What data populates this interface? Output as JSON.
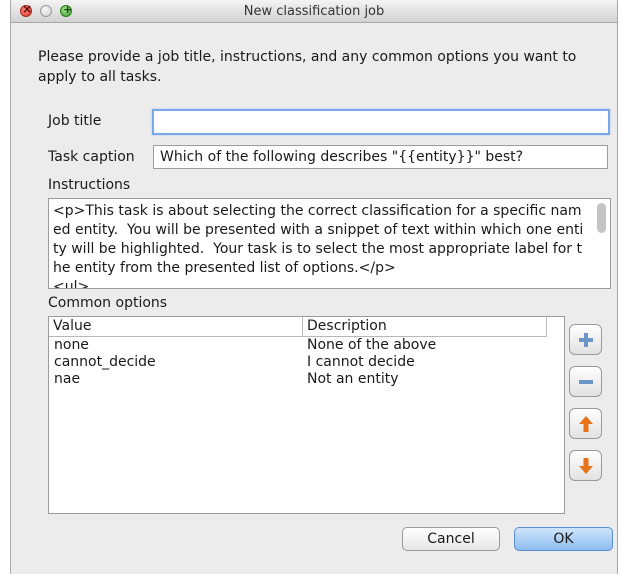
{
  "window": {
    "title": "New classification job"
  },
  "intro": "Please provide a job title, instructions, and any common options you want to apply to all tasks.",
  "form": {
    "job_title_label": "Job title",
    "job_title_value": "",
    "task_caption_label": "Task caption",
    "task_caption_value": "Which of the following describes \"{{entity}}\" best?",
    "instructions_label": "Instructions",
    "instructions_text": "<p>This task is about selecting the correct classification for a specific named entity.  You will be presented with a snippet of text within which one entity will be highlighted.  Your task is to select the most appropriate label for the entity from the presented list of options.</p>\n<ul>"
  },
  "options": {
    "label": "Common options",
    "columns": [
      "Value",
      "Description"
    ],
    "rows": [
      {
        "value": "none",
        "description": "None of the above"
      },
      {
        "value": "cannot_decide",
        "description": "I cannot decide"
      },
      {
        "value": "nae",
        "description": "Not an entity"
      }
    ]
  },
  "side_buttons": {
    "icons": [
      "plus-icon",
      "minus-icon",
      "arrow-up-icon",
      "arrow-down-icon"
    ],
    "colors": {
      "plus_minus": "#6a96c8",
      "arrows": "#e8731b"
    }
  },
  "buttons": {
    "cancel": "Cancel",
    "ok": "OK"
  }
}
